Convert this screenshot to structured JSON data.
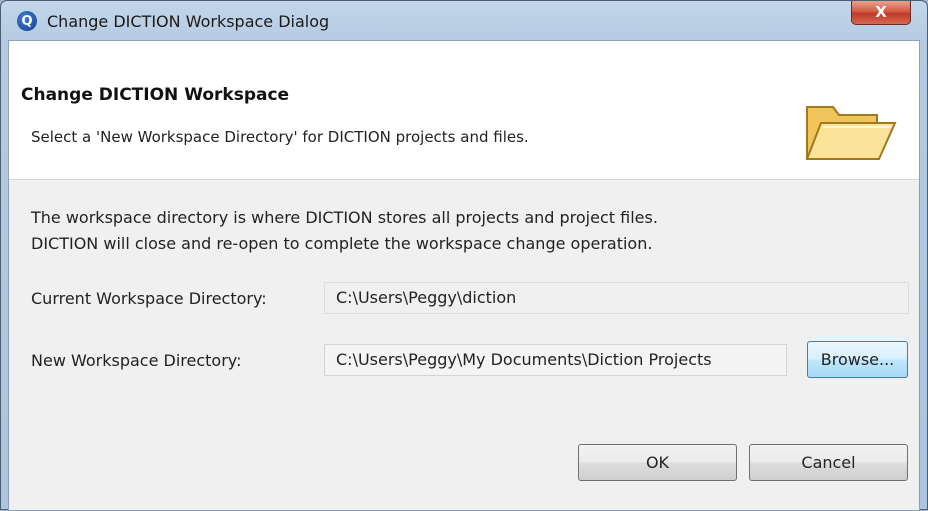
{
  "window": {
    "title": "Change DICTION Workspace Dialog",
    "app_icon_glyph": "Q",
    "close_glyph": "X"
  },
  "header": {
    "title": "Change DICTION Workspace",
    "description": "Select a 'New Workspace Directory' for DICTION projects and files.",
    "icon": "open-folder-icon"
  },
  "intro": {
    "line1": "The workspace directory is where DICTION stores all projects and project files.",
    "line2": "DICTION will close and re-open to complete the workspace change operation."
  },
  "current_workspace": {
    "label": "Current Workspace Directory:",
    "value": "C:\\Users\\Peggy\\diction"
  },
  "new_workspace": {
    "label": "New Workspace Directory:",
    "value": "C:\\Users\\Peggy\\My Documents\\Diction Projects"
  },
  "buttons": {
    "browse": "Browse...",
    "ok": "OK",
    "cancel": "Cancel"
  },
  "colors": {
    "close_button": "#c0392b",
    "browse_focus_border": "#3c7fb1",
    "window_frame": "#b5cbe2"
  }
}
